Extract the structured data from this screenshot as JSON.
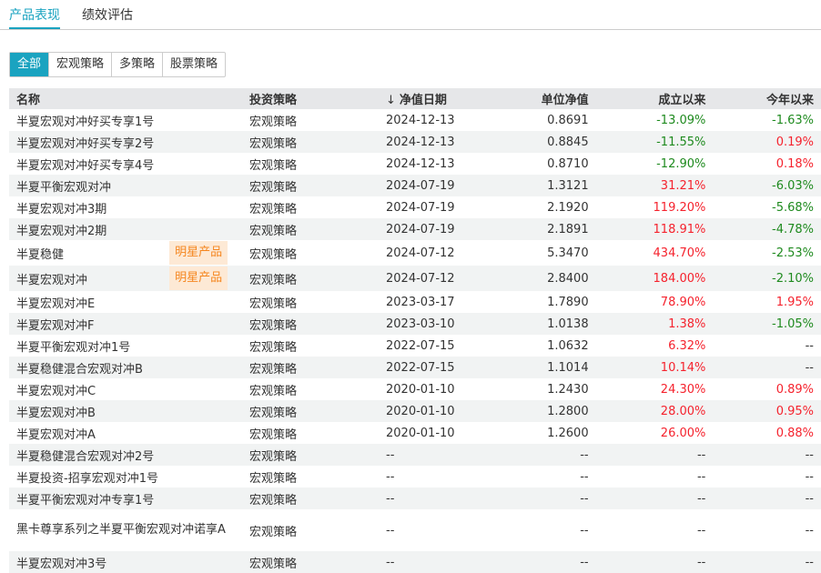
{
  "tabs": [
    {
      "label": "产品表现",
      "active": true
    },
    {
      "label": "绩效评估",
      "active": false
    }
  ],
  "filters": [
    {
      "label": "全部",
      "active": true
    },
    {
      "label": "宏观策略"
    },
    {
      "label": "多策略"
    },
    {
      "label": "股票策略"
    }
  ],
  "headers": {
    "name": "名称",
    "strategy": "投资策略",
    "sort_icon": "↓",
    "date": "净值日期",
    "nav": "单位净值",
    "since": "成立以来",
    "ytd": "今年以来"
  },
  "colors": {
    "accent": "#1aa3c0",
    "up": "#f5222d",
    "down": "#1e8a1e"
  },
  "rows": [
    {
      "name": "半夏宏观对冲好买专享1号",
      "tag": "",
      "strategy": "宏观策略",
      "date": "2024-12-13",
      "nav": "0.8691",
      "since": "-13.09%",
      "ytd": "-1.63%"
    },
    {
      "name": "半夏宏观对冲好买专享2号",
      "tag": "",
      "strategy": "宏观策略",
      "date": "2024-12-13",
      "nav": "0.8845",
      "since": "-11.55%",
      "ytd": "0.19%"
    },
    {
      "name": "半夏宏观对冲好买专享4号",
      "tag": "",
      "strategy": "宏观策略",
      "date": "2024-12-13",
      "nav": "0.8710",
      "since": "-12.90%",
      "ytd": "0.18%"
    },
    {
      "name": "半夏平衡宏观对冲",
      "tag": "",
      "strategy": "宏观策略",
      "date": "2024-07-19",
      "nav": "1.3121",
      "since": "31.21%",
      "ytd": "-6.03%"
    },
    {
      "name": "半夏宏观对冲3期",
      "tag": "",
      "strategy": "宏观策略",
      "date": "2024-07-19",
      "nav": "2.1920",
      "since": "119.20%",
      "ytd": "-5.68%"
    },
    {
      "name": "半夏宏观对冲2期",
      "tag": "",
      "strategy": "宏观策略",
      "date": "2024-07-19",
      "nav": "2.1891",
      "since": "118.91%",
      "ytd": "-4.78%"
    },
    {
      "name": "半夏稳健",
      "tag": "明星产品",
      "strategy": "宏观策略",
      "date": "2024-07-12",
      "nav": "5.3470",
      "since": "434.70%",
      "ytd": "-2.53%"
    },
    {
      "name": "半夏宏观对冲",
      "tag": "明星产品",
      "strategy": "宏观策略",
      "date": "2024-07-12",
      "nav": "2.8400",
      "since": "184.00%",
      "ytd": "-2.10%"
    },
    {
      "name": "半夏宏观对冲E",
      "tag": "",
      "strategy": "宏观策略",
      "date": "2023-03-17",
      "nav": "1.7890",
      "since": "78.90%",
      "ytd": "1.95%"
    },
    {
      "name": "半夏宏观对冲F",
      "tag": "",
      "strategy": "宏观策略",
      "date": "2023-03-10",
      "nav": "1.0138",
      "since": "1.38%",
      "ytd": "-1.05%"
    },
    {
      "name": "半夏平衡宏观对冲1号",
      "tag": "",
      "strategy": "宏观策略",
      "date": "2022-07-15",
      "nav": "1.0632",
      "since": "6.32%",
      "ytd": "--"
    },
    {
      "name": "半夏稳健混合宏观对冲B",
      "tag": "",
      "strategy": "宏观策略",
      "date": "2022-07-15",
      "nav": "1.1014",
      "since": "10.14%",
      "ytd": "--"
    },
    {
      "name": "半夏宏观对冲C",
      "tag": "",
      "strategy": "宏观策略",
      "date": "2020-01-10",
      "nav": "1.2430",
      "since": "24.30%",
      "ytd": "0.89%"
    },
    {
      "name": "半夏宏观对冲B",
      "tag": "",
      "strategy": "宏观策略",
      "date": "2020-01-10",
      "nav": "1.2800",
      "since": "28.00%",
      "ytd": "0.95%"
    },
    {
      "name": "半夏宏观对冲A",
      "tag": "",
      "strategy": "宏观策略",
      "date": "2020-01-10",
      "nav": "1.2600",
      "since": "26.00%",
      "ytd": "0.88%"
    },
    {
      "name": "半夏稳健混合宏观对冲2号",
      "tag": "",
      "strategy": "宏观策略",
      "date": "--",
      "nav": "--",
      "since": "--",
      "ytd": "--"
    },
    {
      "name": "半夏投资-招享宏观对冲1号",
      "tag": "",
      "strategy": "宏观策略",
      "date": "--",
      "nav": "--",
      "since": "--",
      "ytd": "--"
    },
    {
      "name": "半夏平衡宏观对冲专享1号",
      "tag": "",
      "strategy": "宏观策略",
      "date": "--",
      "nav": "--",
      "since": "--",
      "ytd": "--"
    },
    {
      "name": "黑卡尊享系列之半夏平衡宏观对冲诺享A",
      "tag": "",
      "strategy": "宏观策略",
      "date": "--",
      "nav": "--",
      "since": "--",
      "ytd": "--"
    },
    {
      "name": "半夏宏观对冲3号",
      "tag": "",
      "strategy": "宏观策略",
      "date": "--",
      "nav": "--",
      "since": "--",
      "ytd": "--"
    }
  ]
}
